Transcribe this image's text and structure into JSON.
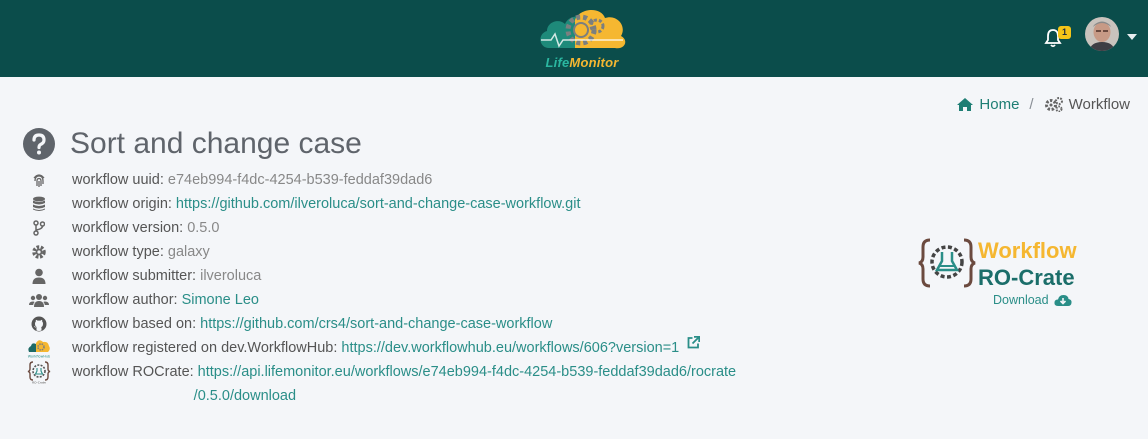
{
  "nav": {
    "logo_text_left": "Life",
    "logo_text_right": "Monitor",
    "notification_count": "1"
  },
  "breadcrumb": {
    "home": "Home",
    "separator": "/",
    "current": "Workflow"
  },
  "workflow": {
    "title": "Sort and change case",
    "rows": [
      {
        "icon": "fingerprint-icon",
        "label": "workflow uuid:",
        "value": "e74eb994-f4dc-4254-b539-feddaf39dad6"
      },
      {
        "icon": "database-icon",
        "label": "workflow origin:",
        "link": "https://github.com/ilveroluca/sort-and-change-case-workflow.git"
      },
      {
        "icon": "code-branch-icon",
        "label": "workflow version:",
        "value": "0.5.0"
      },
      {
        "icon": "gear-icon",
        "label": "workflow type:",
        "value": "galaxy"
      },
      {
        "icon": "user-icon",
        "label": "workflow submitter:",
        "value": "ilveroluca"
      },
      {
        "icon": "users-icon",
        "label": "workflow author:",
        "link": "Simone Leo"
      },
      {
        "icon": "github-icon",
        "label": "workflow based on:",
        "link": "https://github.com/crs4/sort-and-change-case-workflow"
      },
      {
        "icon": "workflowhub-logo-icon",
        "label": "workflow registered on dev.WorkflowHub:",
        "link": "https://dev.workflowhub.eu/workflows/606?version=1"
      },
      {
        "icon": "rocrate-logo-icon",
        "label": "workflow ROCrate:",
        "link_line1": "https://api.lifemonitor.eu/workflows/e74eb994-f4dc-4254-b539-feddaf39dad6/rocrate",
        "link_line2": "/0.5.0/download"
      }
    ]
  },
  "rocrate_badge": {
    "line1": "Workflow",
    "line2": "RO-Crate",
    "download_label": "Download"
  },
  "colors": {
    "topbar": "#0b4d4b",
    "accent_teal": "#2a8e88",
    "accent_yellow": "#f5b731",
    "badge_yellow": "#f5c518"
  }
}
